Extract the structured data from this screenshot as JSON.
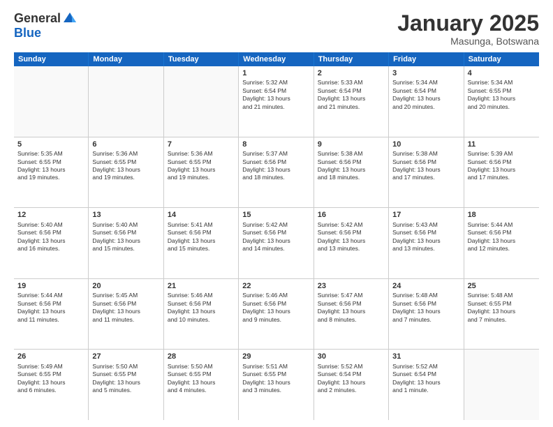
{
  "logo": {
    "general": "General",
    "blue": "Blue"
  },
  "title": "January 2025",
  "location": "Masunga, Botswana",
  "header_days": [
    "Sunday",
    "Monday",
    "Tuesday",
    "Wednesday",
    "Thursday",
    "Friday",
    "Saturday"
  ],
  "rows": [
    [
      {
        "day": "",
        "text": "",
        "empty": true
      },
      {
        "day": "",
        "text": "",
        "empty": true
      },
      {
        "day": "",
        "text": "",
        "empty": true
      },
      {
        "day": "1",
        "text": "Sunrise: 5:32 AM\nSunset: 6:54 PM\nDaylight: 13 hours\nand 21 minutes."
      },
      {
        "day": "2",
        "text": "Sunrise: 5:33 AM\nSunset: 6:54 PM\nDaylight: 13 hours\nand 21 minutes."
      },
      {
        "day": "3",
        "text": "Sunrise: 5:34 AM\nSunset: 6:54 PM\nDaylight: 13 hours\nand 20 minutes."
      },
      {
        "day": "4",
        "text": "Sunrise: 5:34 AM\nSunset: 6:55 PM\nDaylight: 13 hours\nand 20 minutes."
      }
    ],
    [
      {
        "day": "5",
        "text": "Sunrise: 5:35 AM\nSunset: 6:55 PM\nDaylight: 13 hours\nand 19 minutes."
      },
      {
        "day": "6",
        "text": "Sunrise: 5:36 AM\nSunset: 6:55 PM\nDaylight: 13 hours\nand 19 minutes."
      },
      {
        "day": "7",
        "text": "Sunrise: 5:36 AM\nSunset: 6:55 PM\nDaylight: 13 hours\nand 19 minutes."
      },
      {
        "day": "8",
        "text": "Sunrise: 5:37 AM\nSunset: 6:56 PM\nDaylight: 13 hours\nand 18 minutes."
      },
      {
        "day": "9",
        "text": "Sunrise: 5:38 AM\nSunset: 6:56 PM\nDaylight: 13 hours\nand 18 minutes."
      },
      {
        "day": "10",
        "text": "Sunrise: 5:38 AM\nSunset: 6:56 PM\nDaylight: 13 hours\nand 17 minutes."
      },
      {
        "day": "11",
        "text": "Sunrise: 5:39 AM\nSunset: 6:56 PM\nDaylight: 13 hours\nand 17 minutes."
      }
    ],
    [
      {
        "day": "12",
        "text": "Sunrise: 5:40 AM\nSunset: 6:56 PM\nDaylight: 13 hours\nand 16 minutes."
      },
      {
        "day": "13",
        "text": "Sunrise: 5:40 AM\nSunset: 6:56 PM\nDaylight: 13 hours\nand 15 minutes."
      },
      {
        "day": "14",
        "text": "Sunrise: 5:41 AM\nSunset: 6:56 PM\nDaylight: 13 hours\nand 15 minutes."
      },
      {
        "day": "15",
        "text": "Sunrise: 5:42 AM\nSunset: 6:56 PM\nDaylight: 13 hours\nand 14 minutes."
      },
      {
        "day": "16",
        "text": "Sunrise: 5:42 AM\nSunset: 6:56 PM\nDaylight: 13 hours\nand 13 minutes."
      },
      {
        "day": "17",
        "text": "Sunrise: 5:43 AM\nSunset: 6:56 PM\nDaylight: 13 hours\nand 13 minutes."
      },
      {
        "day": "18",
        "text": "Sunrise: 5:44 AM\nSunset: 6:56 PM\nDaylight: 13 hours\nand 12 minutes."
      }
    ],
    [
      {
        "day": "19",
        "text": "Sunrise: 5:44 AM\nSunset: 6:56 PM\nDaylight: 13 hours\nand 11 minutes."
      },
      {
        "day": "20",
        "text": "Sunrise: 5:45 AM\nSunset: 6:56 PM\nDaylight: 13 hours\nand 11 minutes."
      },
      {
        "day": "21",
        "text": "Sunrise: 5:46 AM\nSunset: 6:56 PM\nDaylight: 13 hours\nand 10 minutes."
      },
      {
        "day": "22",
        "text": "Sunrise: 5:46 AM\nSunset: 6:56 PM\nDaylight: 13 hours\nand 9 minutes."
      },
      {
        "day": "23",
        "text": "Sunrise: 5:47 AM\nSunset: 6:56 PM\nDaylight: 13 hours\nand 8 minutes."
      },
      {
        "day": "24",
        "text": "Sunrise: 5:48 AM\nSunset: 6:56 PM\nDaylight: 13 hours\nand 7 minutes."
      },
      {
        "day": "25",
        "text": "Sunrise: 5:48 AM\nSunset: 6:55 PM\nDaylight: 13 hours\nand 7 minutes."
      }
    ],
    [
      {
        "day": "26",
        "text": "Sunrise: 5:49 AM\nSunset: 6:55 PM\nDaylight: 13 hours\nand 6 minutes."
      },
      {
        "day": "27",
        "text": "Sunrise: 5:50 AM\nSunset: 6:55 PM\nDaylight: 13 hours\nand 5 minutes."
      },
      {
        "day": "28",
        "text": "Sunrise: 5:50 AM\nSunset: 6:55 PM\nDaylight: 13 hours\nand 4 minutes."
      },
      {
        "day": "29",
        "text": "Sunrise: 5:51 AM\nSunset: 6:55 PM\nDaylight: 13 hours\nand 3 minutes."
      },
      {
        "day": "30",
        "text": "Sunrise: 5:52 AM\nSunset: 6:54 PM\nDaylight: 13 hours\nand 2 minutes."
      },
      {
        "day": "31",
        "text": "Sunrise: 5:52 AM\nSunset: 6:54 PM\nDaylight: 13 hours\nand 1 minute."
      },
      {
        "day": "",
        "text": "",
        "empty": true
      }
    ]
  ]
}
